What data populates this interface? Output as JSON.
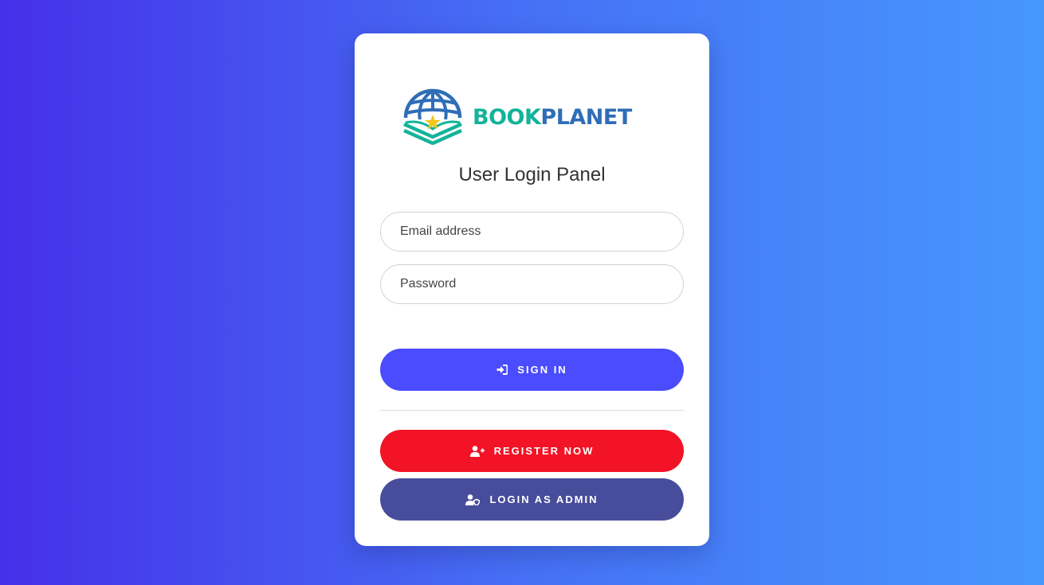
{
  "brand": {
    "part1": "BOOK",
    "part2": "PLANET",
    "logo_icon": "globe-book-star-icon",
    "colors": {
      "teal": "#12b39a",
      "blue": "#2f6db7",
      "star": "#f5c518"
    }
  },
  "panel": {
    "title": "User Login Panel"
  },
  "form": {
    "email_placeholder": "Email address",
    "password_placeholder": "Password"
  },
  "buttons": {
    "signin": {
      "label": "SIGN IN",
      "icon": "sign-in-icon",
      "color": "#4a4cfd"
    },
    "register": {
      "label": "REGISTER NOW",
      "icon": "user-plus-icon",
      "color": "#f21326"
    },
    "admin": {
      "label": "LOGIN AS ADMIN",
      "icon": "user-shield-icon",
      "color": "#474d9b"
    }
  },
  "background": {
    "gradient_start": "#4530e9",
    "gradient_end": "#4797fd"
  }
}
